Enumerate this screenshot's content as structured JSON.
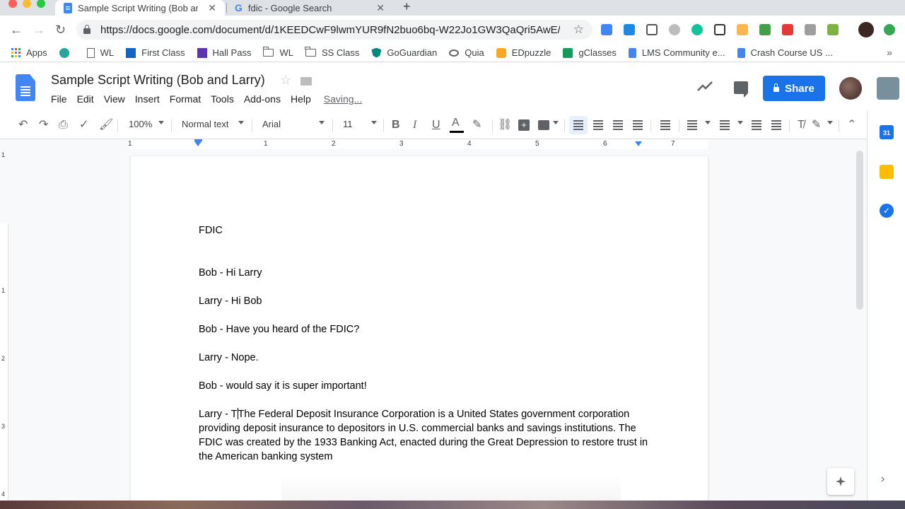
{
  "browser": {
    "tabs": [
      {
        "title": "Sample Script Writing (Bob and Larry)",
        "active": true
      },
      {
        "title": "fdic - Google Search",
        "active": false
      }
    ],
    "close_glyph": "✕",
    "new_tab_glyph": "+",
    "url": "https://docs.google.com/document/d/1KEEDCwF9lwmYUR9fN2buo6bq-W22Jo1GW3QaQri5AwE/e...",
    "bookmarks": [
      {
        "label": "Apps",
        "icon": "apps-grid-icon"
      },
      {
        "label": "",
        "icon": "schoology-icon"
      },
      {
        "label": "WL",
        "icon": "page-icon"
      },
      {
        "label": "First Class",
        "icon": "school-icon"
      },
      {
        "label": "Hall Pass",
        "icon": "hallpass-icon"
      },
      {
        "label": "WL",
        "icon": "folder-icon"
      },
      {
        "label": "SS Class",
        "icon": "folder-icon"
      },
      {
        "label": "GoGuardian",
        "icon": "shield-icon"
      },
      {
        "label": "Quia",
        "icon": "quia-icon"
      },
      {
        "label": "EDpuzzle",
        "icon": "edpuzzle-icon"
      },
      {
        "label": "gClasses",
        "icon": "gclasses-icon"
      },
      {
        "label": "LMS Community e...",
        "icon": "docs-icon"
      },
      {
        "label": "Crash Course US ...",
        "icon": "docs-icon"
      }
    ],
    "bookmarks_more": "»"
  },
  "docs": {
    "title": "Sample Script Writing (Bob and Larry)",
    "menu": [
      "File",
      "Edit",
      "View",
      "Insert",
      "Format",
      "Tools",
      "Add-ons",
      "Help"
    ],
    "save_status": "Saving...",
    "share_label": "Share",
    "toolbar": {
      "zoom": "100%",
      "style": "Normal text",
      "font": "Arial",
      "font_size": "11",
      "bold": "B",
      "italic": "I",
      "underline": "U",
      "text_color": "A"
    },
    "ruler_numbers": [
      "1",
      "1",
      "2",
      "3",
      "4",
      "5",
      "6",
      "7"
    ],
    "vruler_numbers": [
      "1",
      "1",
      "2",
      "3",
      "4"
    ],
    "calendar_badge": "31"
  },
  "document": {
    "heading": "FDIC",
    "lines": [
      "Bob - Hi Larry",
      "Larry - Hi Bob",
      "Bob - Have you heard of the FDIC?",
      "Larry - Nope.",
      "Bob - would say it is super important!"
    ],
    "last_prefix": "Larry - T",
    "last_body": "The Federal Deposit Insurance Corporation is a United States government corporation providing deposit insurance to depositors in U.S. commercial banks and savings institutions. The FDIC was created by the 1933 Banking Act, enacted during the Great Depression to restore trust in the American banking system"
  },
  "colors": {
    "docs_blue": "#4285f4",
    "share_blue": "#1a73e8",
    "tab_strip": "#dee1e6"
  }
}
